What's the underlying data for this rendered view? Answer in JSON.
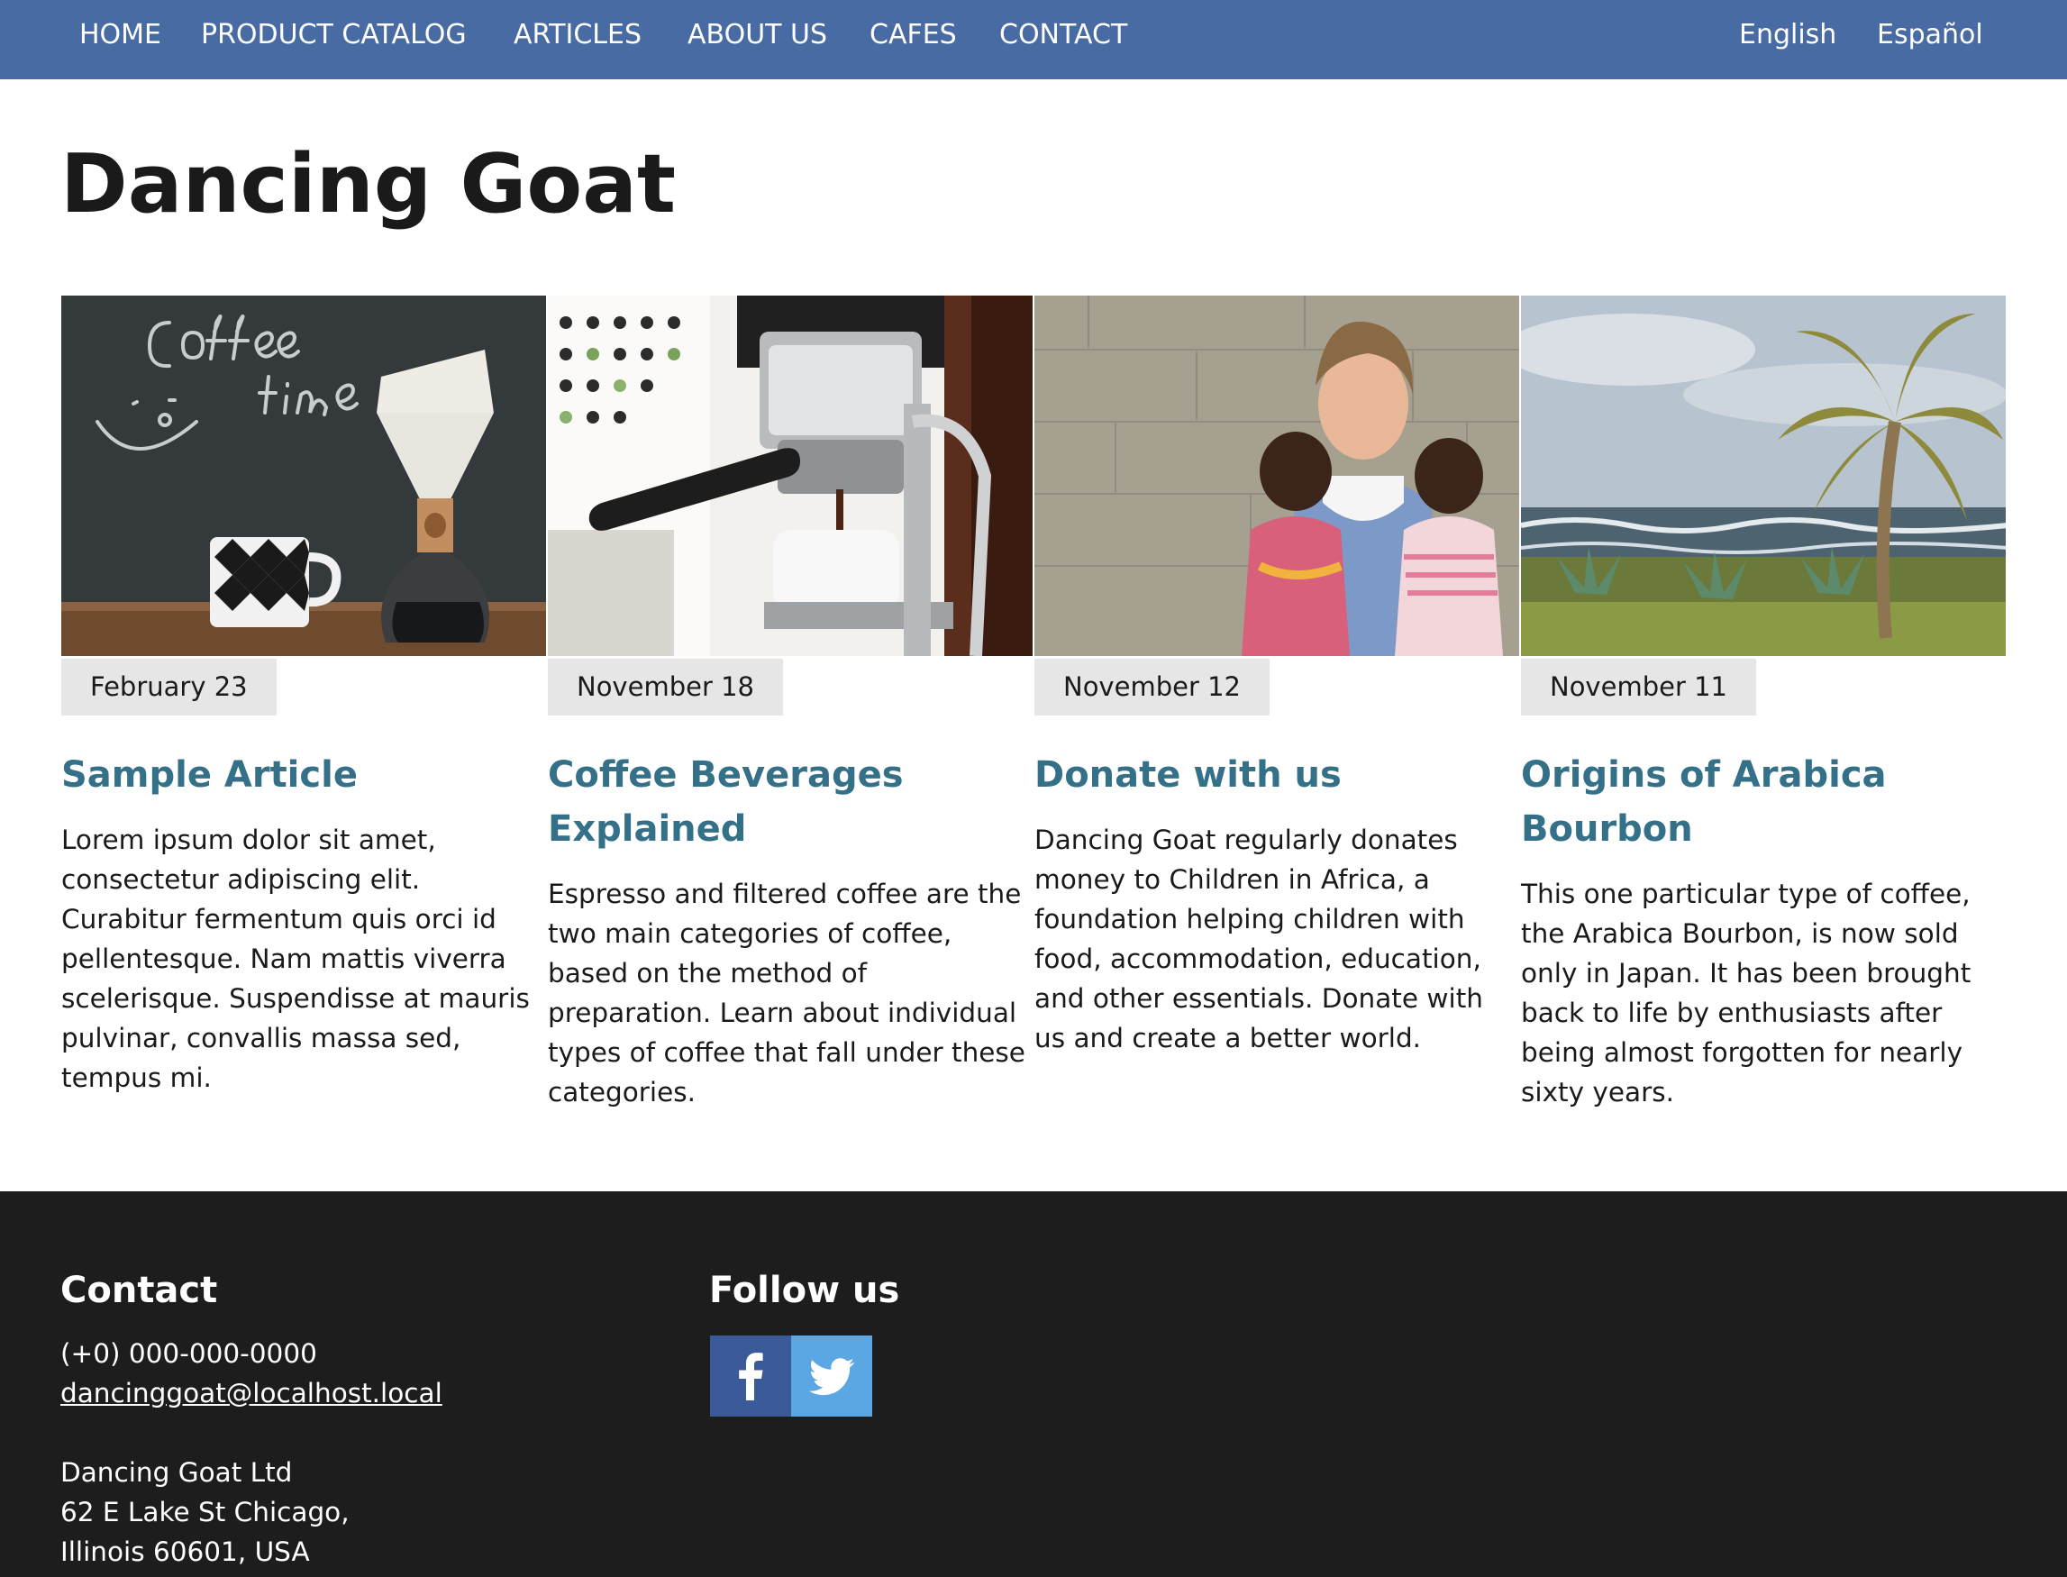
{
  "nav": {
    "items": [
      "HOME",
      "PRODUCT CATALOG",
      "ARTICLES",
      "ABOUT US",
      "CAFES",
      "CONTACT"
    ],
    "languages": [
      "English",
      "Español"
    ],
    "background_color": "#476ba2"
  },
  "page": {
    "title": "Dancing Goat"
  },
  "articles": [
    {
      "date": "February 23",
      "title": "Sample Article",
      "summary": "Lorem ipsum dolor sit amet, consectetur adipiscing elit. Curabitur fermentum quis orci id pellentesque. Nam mattis viverra scelerisque. Suspendisse at mauris pulvinar, convallis massa sed, tempus mi.",
      "image": "coffee-time-chalkboard-photo"
    },
    {
      "date": "November 18",
      "title": "Coffee Beverages Explained",
      "summary": "Espresso and filtered coffee are the two main categories of coffee, based on the method of preparation. Learn about individual types of coffee that fall under these categories.",
      "image": "espresso-machine-photo"
    },
    {
      "date": "November 12",
      "title": "Donate with us",
      "summary": "Dancing Goat regularly donates money to Children in Africa, a foundation helping children with food, accommodation, education, and other essentials. Donate with us and create a better world.",
      "image": "woman-with-children-photo"
    },
    {
      "date": "November 11",
      "title": "Origins of Arabica Bourbon",
      "summary": "This one particular type of coffee, the Arabica Bourbon, is now sold only in Japan. It has been brought back to life by enthusiasts after being almost forgotten for nearly sixty years.",
      "image": "palm-tree-coast-photo"
    }
  ],
  "colors": {
    "article_title": "#347189",
    "date_badge": "#e6e6e6",
    "footer_background": "#1d1d1d",
    "facebook": "#3b5a99",
    "twitter": "#5aa7e4"
  },
  "footer": {
    "contact_heading": "Contact",
    "phone": "(+0) 000-000-0000",
    "email": "dancinggoat@localhost.local",
    "company": "Dancing Goat Ltd",
    "address_line1": "62 E Lake St Chicago,",
    "address_line2": "Illinois 60601, USA",
    "follow_heading": "Follow us",
    "social": [
      "facebook-icon",
      "twitter-icon"
    ]
  }
}
